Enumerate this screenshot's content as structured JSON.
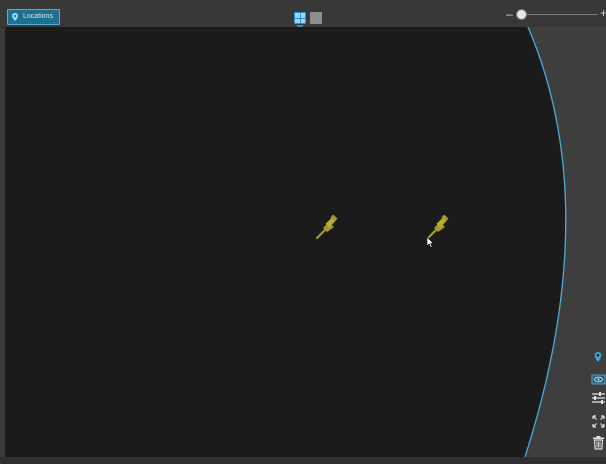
{
  "toolbar": {
    "locations_tab_label": "Locations",
    "view_modes": [
      "grid-view-icon",
      "single-view-icon"
    ],
    "active_view_mode": "grid"
  },
  "colors": {
    "accent": "#2a8fc4",
    "map_background": "#1b1b1b",
    "globe_outline": "#4fa8d8",
    "pin": "#a39b2a",
    "chrome": "#3c3c3c"
  },
  "map": {
    "pins": [
      {
        "name": "location-pin-1",
        "icon": "pushpin-icon"
      },
      {
        "name": "location-pin-2",
        "icon": "pushpin-icon"
      }
    ]
  },
  "side_tools": [
    {
      "name": "location-marker-button",
      "icon": "map-pin-icon"
    },
    {
      "name": "visibility-button",
      "icon": "eye-icon"
    },
    {
      "name": "filter-settings-button",
      "icon": "sliders-icon"
    },
    {
      "name": "fit-to-view-button",
      "icon": "expand-icon"
    },
    {
      "name": "delete-button",
      "icon": "trash-icon"
    }
  ]
}
